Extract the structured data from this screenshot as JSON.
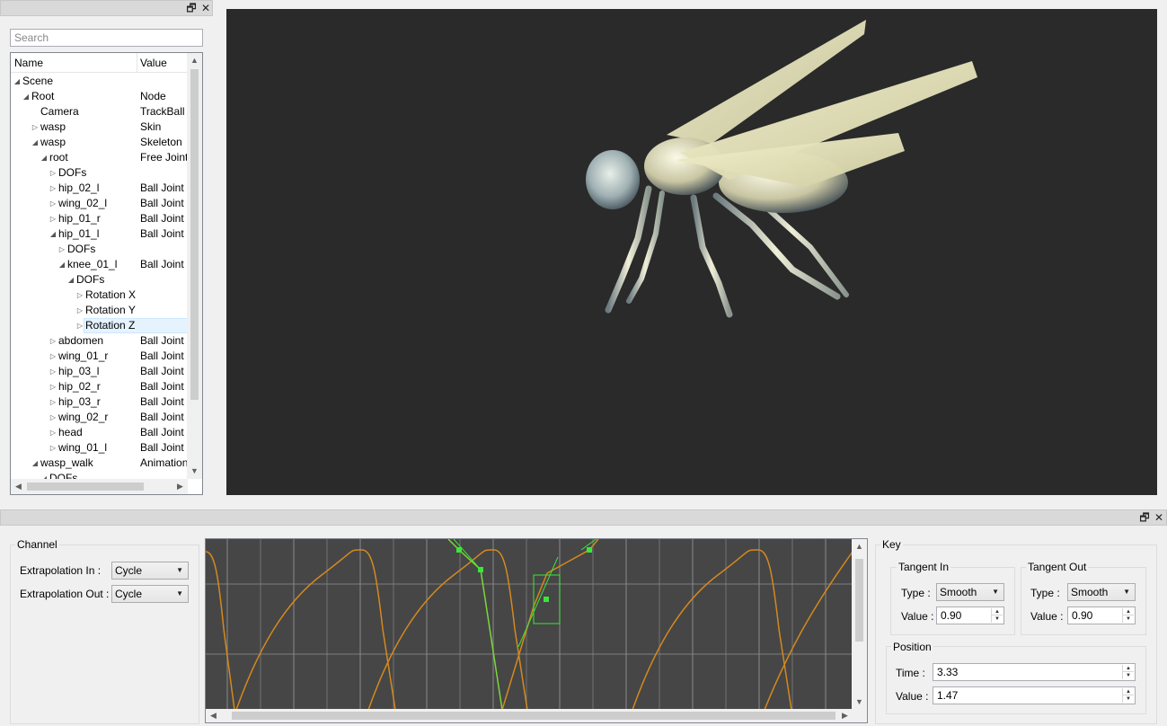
{
  "scene_panel": {
    "search_placeholder": "Search",
    "columns": {
      "name": "Name",
      "value": "Value"
    },
    "rows": [
      {
        "name": "Scene",
        "value": ""
      },
      {
        "name": "Root",
        "value": "Node"
      },
      {
        "name": "Camera",
        "value": "TrackBall"
      },
      {
        "name": "wasp",
        "value": "Skin"
      },
      {
        "name": "wasp",
        "value": "Skeleton"
      },
      {
        "name": "root",
        "value": "Free Joint"
      },
      {
        "name": "DOFs",
        "value": ""
      },
      {
        "name": "hip_02_l",
        "value": "Ball Joint"
      },
      {
        "name": "wing_02_l",
        "value": "Ball Joint"
      },
      {
        "name": "hip_01_r",
        "value": "Ball Joint"
      },
      {
        "name": "hip_01_l",
        "value": "Ball Joint"
      },
      {
        "name": "DOFs",
        "value": ""
      },
      {
        "name": "knee_01_l",
        "value": "Ball Joint"
      },
      {
        "name": "DOFs",
        "value": ""
      },
      {
        "name": "Rotation X",
        "value": ""
      },
      {
        "name": "Rotation Y",
        "value": ""
      },
      {
        "name": "Rotation Z",
        "value": ""
      },
      {
        "name": "abdomen",
        "value": "Ball Joint"
      },
      {
        "name": "wing_01_r",
        "value": "Ball Joint"
      },
      {
        "name": "hip_03_l",
        "value": "Ball Joint"
      },
      {
        "name": "hip_02_r",
        "value": "Ball Joint"
      },
      {
        "name": "hip_03_r",
        "value": "Ball Joint"
      },
      {
        "name": "wing_02_r",
        "value": "Ball Joint"
      },
      {
        "name": "head",
        "value": "Ball Joint"
      },
      {
        "name": "wing_01_l",
        "value": "Ball Joint"
      },
      {
        "name": "wasp_walk",
        "value": "Animation"
      },
      {
        "name": "DOFs",
        "value": ""
      }
    ]
  },
  "channel": {
    "title": "Channel",
    "extrapolation_in_label": "Extrapolation In :",
    "extrapolation_in_value": "Cycle",
    "extrapolation_out_label": "Extrapolation Out :",
    "extrapolation_out_value": "Cycle"
  },
  "key": {
    "title": "Key",
    "tangent_in": {
      "title": "Tangent In",
      "type_label": "Type :",
      "type_value": "Smooth",
      "value_label": "Value :",
      "value": "0.90"
    },
    "tangent_out": {
      "title": "Tangent Out",
      "type_label": "Type :",
      "type_value": "Smooth",
      "value_label": "Value :",
      "value": "0.90"
    },
    "position": {
      "title": "Position",
      "time_label": "Time :",
      "time_value": "3.33",
      "value_label": "Value :",
      "value": "1.47"
    }
  },
  "colors": {
    "viewport_bg": "#2a2a2a",
    "curve_bg": "#464646",
    "curve_line": "#d4891e",
    "selected_curve": "#7cd63c",
    "key_point": "#39e639",
    "grid_line": "#8c8c8c"
  }
}
